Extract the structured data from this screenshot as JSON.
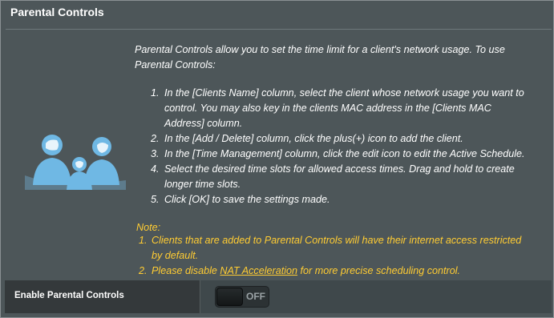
{
  "panel": {
    "title": "Parental Controls"
  },
  "description": {
    "line1": "Parental Controls allow you to set the time limit for a client's network usage. To use",
    "line2": "Parental Controls:"
  },
  "steps": [
    {
      "num": "1.",
      "lines": [
        "In the [Clients Name] column, select the client whose network usage you want to",
        "control. You may also key in the clients MAC address in the [Clients MAC",
        "Address] column."
      ]
    },
    {
      "num": "2.",
      "lines": [
        "In the [Add / Delete] column, click the plus(+) icon to add the client."
      ]
    },
    {
      "num": "3.",
      "lines": [
        "In the [Time Management] column, click the edit icon to edit the Active Schedule."
      ]
    },
    {
      "num": "4.",
      "lines": [
        "Select the desired time slots for allowed access times. Drag and hold to create",
        "longer time slots."
      ]
    },
    {
      "num": "5.",
      "lines": [
        "Click [OK] to save the settings made."
      ]
    }
  ],
  "note": {
    "label": "Note:",
    "item1_num": "1.",
    "item1_line1": "Clients that are added to Parental Controls will have their internet access restricted",
    "item1_line2": "by default.",
    "item2_num": "2.",
    "item2_prefix": "Please disable ",
    "item2_link": "NAT Acceleration",
    "item2_suffix": " for more precise scheduling control."
  },
  "setting": {
    "label": "Enable Parental Controls",
    "toggle_state": "OFF"
  },
  "colors": {
    "background": "#4d5659",
    "note_text": "#ffcc33",
    "icon_blue": "#6fb8e4"
  },
  "icons": {
    "family": "family-icon"
  }
}
